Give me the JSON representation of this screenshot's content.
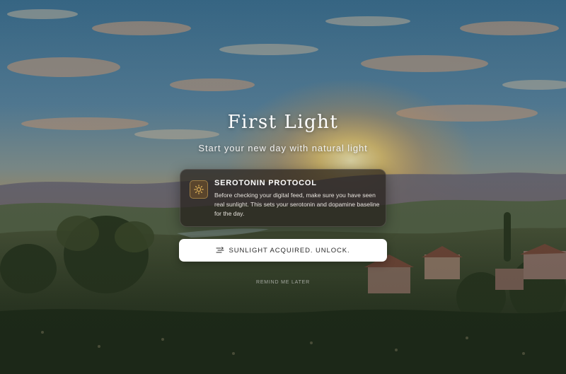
{
  "page": {
    "title": "First Light",
    "subtitle": "Start your new day with natural light"
  },
  "card": {
    "icon": "sun-icon",
    "heading": "SEROTONIN PROTOCOL",
    "body": "Before checking your digital feed, make sure you have seen real sunlight. This sets your serotonin and dopamine baseline for the day."
  },
  "actions": {
    "unlock_icon": "sunrise-haze-icon",
    "unlock_label": "SUNLIGHT ACQUIRED. UNLOCK.",
    "remind_label": "REMIND ME LATER"
  },
  "colors": {
    "accent": "#e0b35a",
    "card_bg": "#26201c",
    "button_bg": "#ffffff",
    "button_text": "#2a2a2a"
  }
}
